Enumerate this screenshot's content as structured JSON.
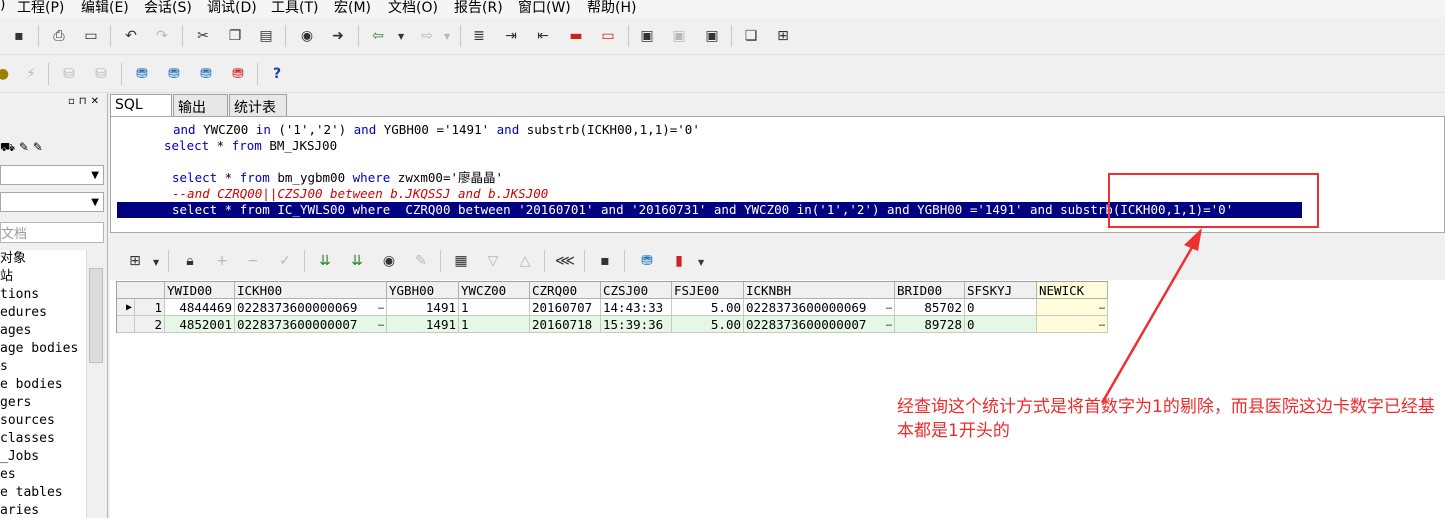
{
  "menu": [
    "工程(P)",
    "编辑(E)",
    "会话(S)",
    "调试(D)",
    "工具(T)",
    "宏(M)",
    "文档(O)",
    "报告(R)",
    "窗口(W)",
    "帮助(H)"
  ],
  "menu_partial_prefix": ")",
  "tabs": [
    {
      "label": "SQL",
      "active": true
    },
    {
      "label": "输出",
      "active": false
    },
    {
      "label": "统计表",
      "active": false
    }
  ],
  "left_panel": {
    "search_placeholder": "文档",
    "objects_label": "对象",
    "items": [
      "站",
      "tions",
      "edures",
      "ages",
      "age bodies",
      "s",
      "e bodies",
      "gers",
      "sources",
      "classes",
      "_Jobs",
      "es",
      "e tables",
      "aries"
    ]
  },
  "editor": {
    "lines": [
      {
        "segments": [
          [
            "kw",
            "and "
          ],
          [
            "str",
            "YWCZ00 "
          ],
          [
            "kw",
            "in"
          ],
          [
            "str",
            " ('1','2') "
          ],
          [
            "kw",
            "and"
          ],
          [
            "str",
            " YGBH00 ='1491' "
          ],
          [
            "kw",
            "and"
          ],
          [
            "str",
            " substrb(ICKH00,1,1)='0'"
          ]
        ]
      },
      {
        "segments": [
          [
            "kw",
            "select"
          ],
          [
            "str",
            " * "
          ],
          [
            "kw",
            "from"
          ],
          [
            "str",
            " BM_JKSJ00"
          ]
        ]
      },
      {
        "segments": []
      },
      {
        "segments": [
          [
            "kw",
            "select"
          ],
          [
            "str",
            " * "
          ],
          [
            "kw",
            "from"
          ],
          [
            "str",
            " bm_ygbm00 "
          ],
          [
            "kw",
            "where"
          ],
          [
            "str",
            " zwxm00='廖晶晶'"
          ]
        ]
      },
      {
        "segments": [
          [
            "cmt",
            "--and CZRQ00||CZSJ00 between b.JKQSSJ and b.JKSJ00"
          ]
        ]
      },
      {
        "segments": [
          [
            "kw",
            "select"
          ],
          [
            "str",
            " * "
          ],
          [
            "kw",
            "from"
          ],
          [
            "str",
            " IC_YWLS00 "
          ],
          [
            "kw",
            "where"
          ],
          [
            "str",
            "  CZRQ00 "
          ],
          [
            "kw",
            "between"
          ],
          [
            "str",
            " '20160701' "
          ],
          [
            "kw",
            "and"
          ],
          [
            "str",
            " '20160731' "
          ],
          [
            "kw",
            "and"
          ],
          [
            "str",
            " YWCZ00 "
          ],
          [
            "kw",
            "in"
          ],
          [
            "str",
            "('1','2') "
          ],
          [
            "kw",
            "and"
          ],
          [
            "str",
            " YGBH00 ='1491' "
          ],
          [
            "kw",
            "and"
          ],
          [
            "str",
            " substrb(ICKH00,1,1)='0'"
          ]
        ],
        "selected": true
      }
    ]
  },
  "grid": {
    "columns": [
      "YWID00",
      "ICKH00",
      "YGBH00",
      "YWCZ00",
      "CZRQ00",
      "CZSJ00",
      "FSJE00",
      "ICKNBH",
      "BRID00",
      "SFSKYJ",
      "NEWICK"
    ],
    "rows": [
      {
        "num": "1",
        "cells": [
          "4844469",
          "0228373600000069",
          "1491",
          "1",
          "20160707",
          "14:43:33",
          "5.00",
          "0228373600000069",
          "85702",
          "0",
          ""
        ]
      },
      {
        "num": "2",
        "cells": [
          "4852001",
          "0228373600000007",
          "1491",
          "1",
          "20160718",
          "15:39:36",
          "5.00",
          "0228373600000007",
          "89728",
          "0",
          ""
        ]
      }
    ],
    "ellipsis": "…"
  },
  "annotation": {
    "text": "经查询这个统计方式是将首数字为1的剔除，而县医院这边卡数字已经基本都是1开头的",
    "color": "#ee2a2a"
  }
}
